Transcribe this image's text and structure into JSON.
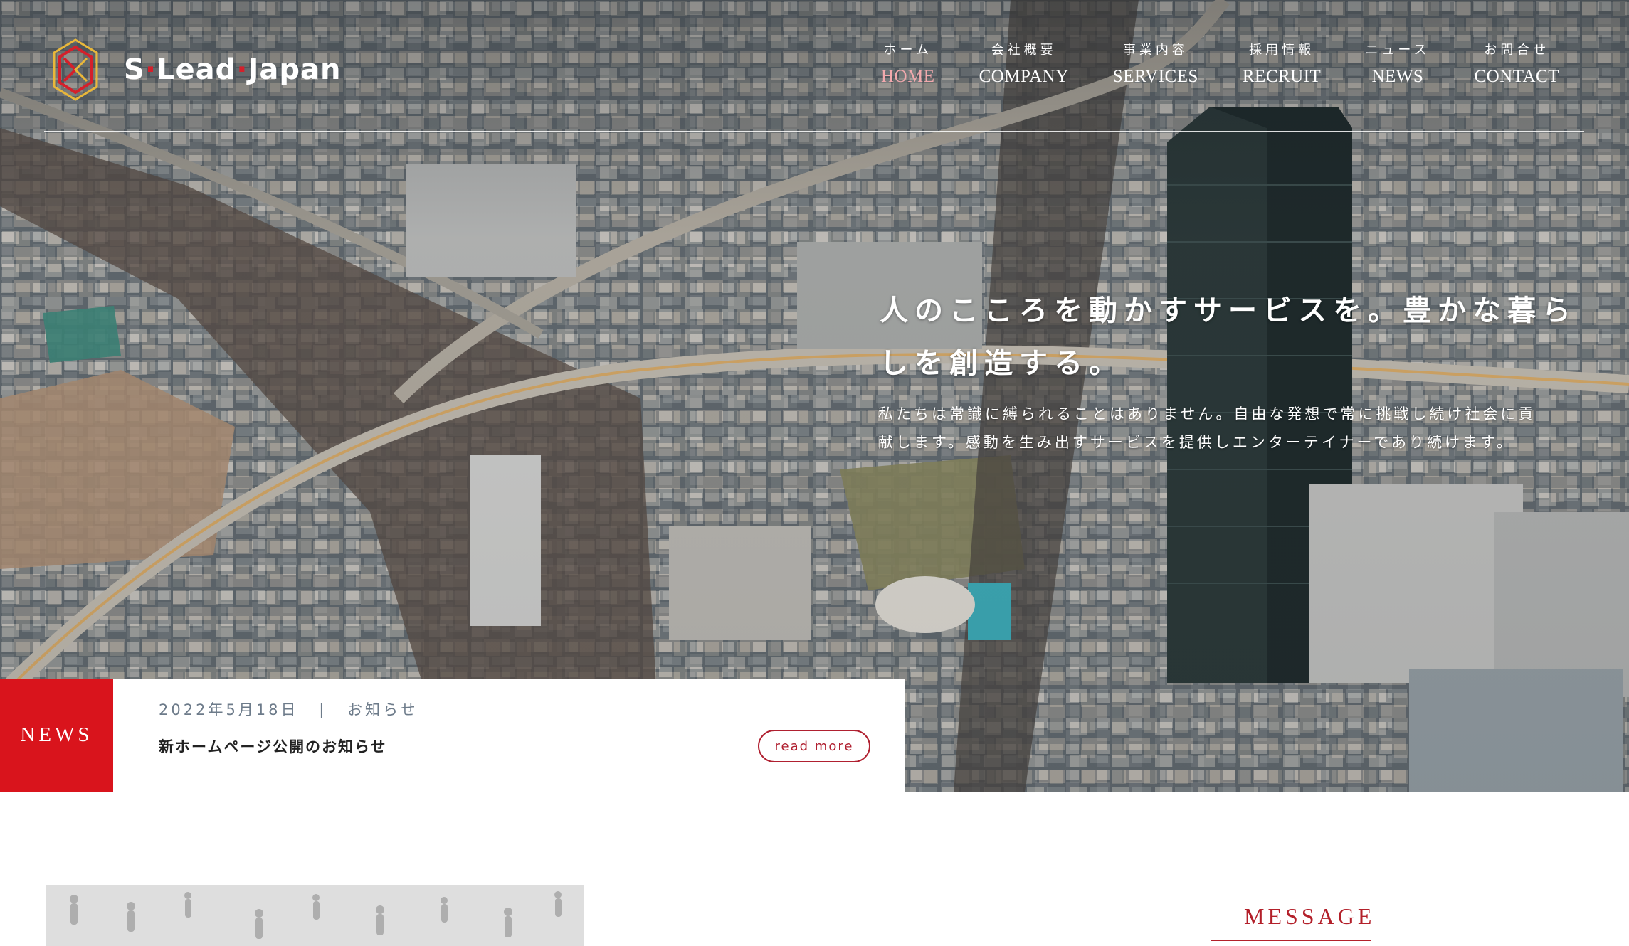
{
  "header": {
    "logo": {
      "text_a": "S",
      "text_b": "Lead",
      "text_c": "Japan"
    },
    "nav": [
      {
        "jp": "ホーム",
        "en": "HOME",
        "active": true
      },
      {
        "jp": "会社概要",
        "en": "COMPANY"
      },
      {
        "jp": "事業内容",
        "en": "SERVICES"
      },
      {
        "jp": "採用情報",
        "en": "RECRUIT"
      },
      {
        "jp": "ニュース",
        "en": "NEWS"
      },
      {
        "jp": "お問合せ",
        "en": "CONTACT"
      }
    ]
  },
  "hero": {
    "tagline_line1": "人のこころを動かすサービスを。豊かな暮ら",
    "tagline_line2": "しを創造する。",
    "subcopy_line1": "私たちは常識に縛られることはありません。自由な発想で常に挑戦し続け社会に貢",
    "subcopy_line2": "献します。感動を生み出すサービスを提供しエンターテイナーであり続けます。"
  },
  "news": {
    "label": "NEWS",
    "date": "2022年5月18日",
    "separator": "|",
    "category": "お知らせ",
    "title": "新ホームページ公開のお知らせ",
    "read_more": "read more"
  },
  "message": {
    "heading": "MESSAGE"
  },
  "colors": {
    "accent": "#d9141c",
    "heading_red": "#b3202a",
    "nav_active": "#f2a9ad"
  },
  "icons": {
    "logo": "sleadjapan-logo-icon"
  }
}
